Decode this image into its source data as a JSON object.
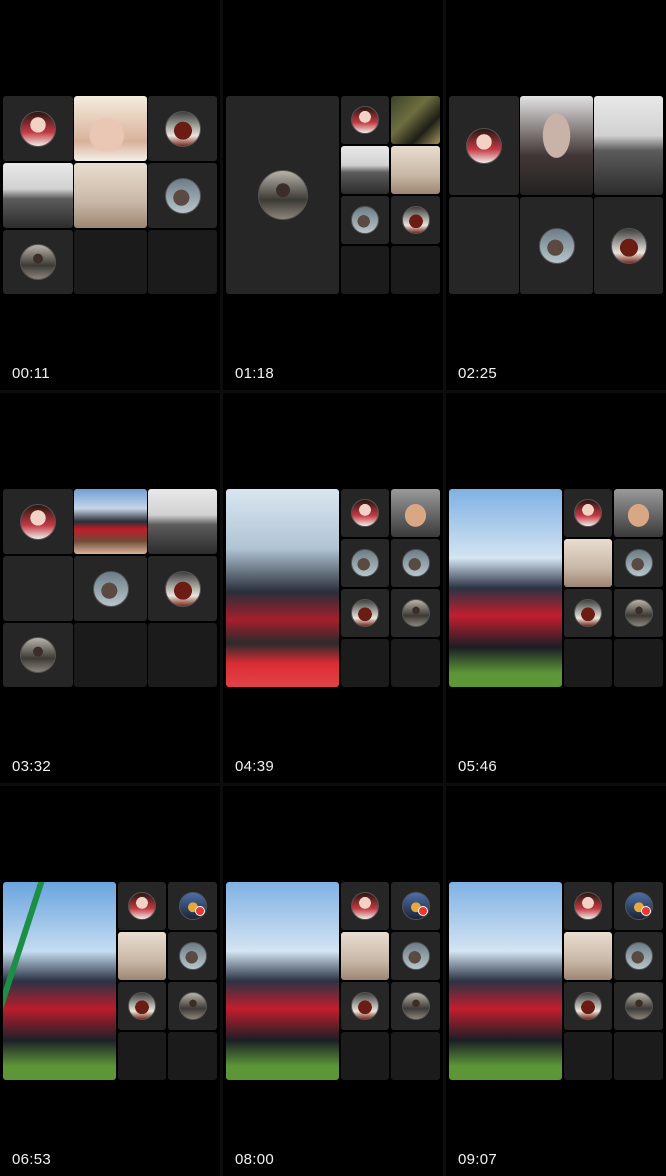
{
  "cells": [
    {
      "timestamp": "00:11"
    },
    {
      "timestamp": "01:18"
    },
    {
      "timestamp": "02:25"
    },
    {
      "timestamp": "03:32"
    },
    {
      "timestamp": "04:39"
    },
    {
      "timestamp": "05:46"
    },
    {
      "timestamp": "06:53"
    },
    {
      "timestamp": "08:00"
    },
    {
      "timestamp": "09:07"
    }
  ],
  "colors": {
    "background": "#000000",
    "tile": "#262626",
    "timestamp_text": "#f2f2f2"
  }
}
